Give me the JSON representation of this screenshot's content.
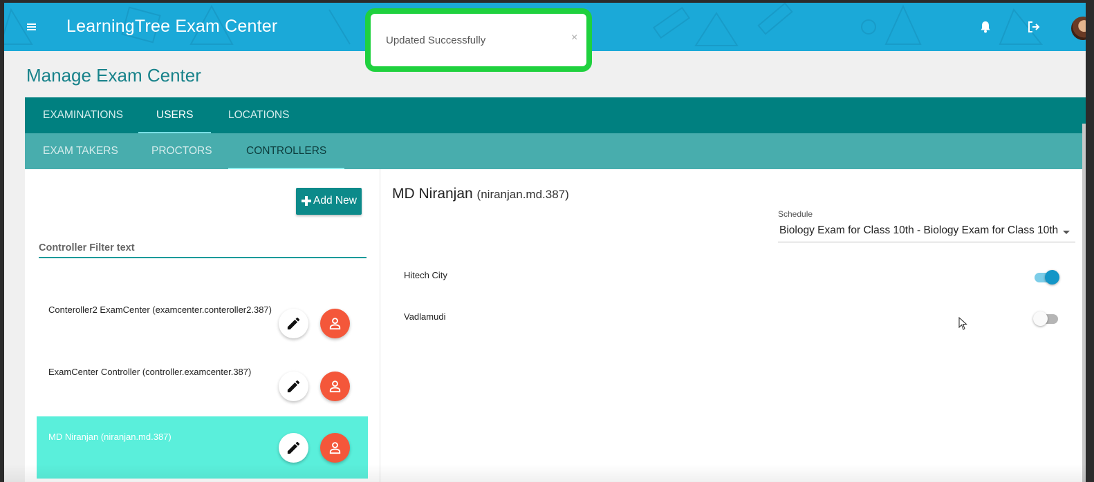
{
  "app": {
    "title": "LearningTree Exam Center"
  },
  "toast": {
    "message": "Updated Successfully",
    "close_glyph": "×",
    "border_color": "#1fd13e"
  },
  "page": {
    "title": "Manage Exam Center"
  },
  "primary_tabs": [
    {
      "label": "EXAMINATIONS",
      "active": false
    },
    {
      "label": "USERS",
      "active": true
    },
    {
      "label": "LOCATIONS",
      "active": false
    }
  ],
  "secondary_tabs": [
    {
      "label": "EXAM TAKERS",
      "active": false
    },
    {
      "label": "PROCTORS",
      "active": false
    },
    {
      "label": "CONTROLLERS",
      "active": true
    }
  ],
  "controllers": {
    "add_button": "Add New",
    "filter_label": "Controller Filter text",
    "items": [
      {
        "name": "Conteroller2 ExamCenter (examcenter.conteroller2.387)",
        "selected": false
      },
      {
        "name": "ExamCenter Controller (controller.examcenter.387)",
        "selected": false
      },
      {
        "name": "MD Niranjan (niranjan.md.387)",
        "selected": true
      }
    ]
  },
  "detail": {
    "name": "MD Niranjan",
    "username": "(niranjan.md.387)",
    "schedule_label": "Schedule",
    "schedule_value": "Biology Exam for Class 10th - Biology Exam for Class 10th",
    "locations": [
      {
        "name": "Hitech City",
        "enabled": true
      },
      {
        "name": "Vadlamudi",
        "enabled": false
      }
    ]
  },
  "icons": {
    "menu": "menu-icon",
    "bell": "bell-icon",
    "logout": "logout-icon",
    "edit": "pencil-icon",
    "user": "person-icon",
    "add": "plus-icon"
  },
  "colors": {
    "topbar": "#1ba9d8",
    "primary_tabs": "#008080",
    "secondary_tabs": "#48adad",
    "selected_row": "#5aefdb",
    "accent_button": "#0c8a8a",
    "user_button": "#f4573a",
    "toggle_on": "#1496c7"
  }
}
